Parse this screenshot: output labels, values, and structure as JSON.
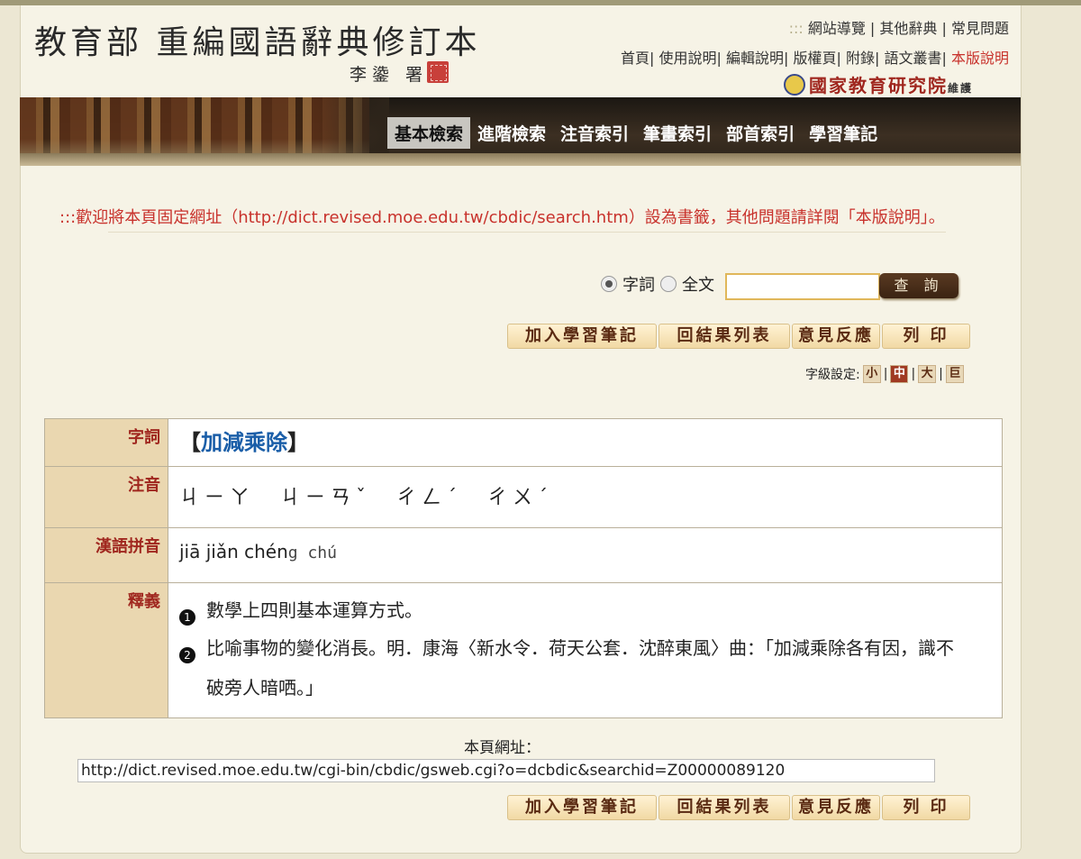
{
  "header": {
    "site_title": "教育部 重編國語辭典修訂本",
    "calligrapher": "李鍌 署",
    "top_links": [
      "網站導覽",
      "其他辭典",
      "常見問題"
    ],
    "main_links": [
      "首頁",
      "使用說明",
      "編輯說明",
      "版權頁",
      "附錄",
      "語文叢書",
      "本版說明"
    ],
    "institute": "國家教育研究院",
    "institute_suffix": "維護"
  },
  "nav": {
    "tabs": [
      "基本檢索",
      "進階檢索",
      "注音索引",
      "筆畫索引",
      "部首索引",
      "學習筆記"
    ],
    "active": "基本檢索"
  },
  "notice": ":::歡迎將本頁固定網址（http://dict.revised.moe.edu.tw/cbdic/search.htm）設為書籤，其他問題請詳閱「本版說明」。",
  "search": {
    "option_word": "字詞",
    "option_fulltext": "全文",
    "selected": "字詞",
    "value": "",
    "button": "查 詢"
  },
  "actions": {
    "add_note": "加入學習筆記",
    "back_results": "回結果列表",
    "feedback": "意見反應",
    "print": "列 印"
  },
  "font_size": {
    "label": "字級設定:",
    "small": "小",
    "mid": "中",
    "big": "大",
    "huge": "巨",
    "selected": "中"
  },
  "entry": {
    "labels": {
      "word": "字詞",
      "zhuyin": "注音",
      "pinyin": "漢語拼音",
      "meaning": "釋義"
    },
    "bracket_open": "【",
    "word": "加減乘除",
    "bracket_close": "】",
    "zhuyin": "ㄐㄧㄚ　ㄐㄧㄢˇ　ㄔㄥˊ　ㄔㄨˊ",
    "pinyin_a": "jiā jiǎn chén",
    "pinyin_b": "g chú",
    "definitions": [
      {
        "num": "1",
        "text": "數學上四則基本運算方式。"
      },
      {
        "num": "2",
        "text": "比喻事物的變化消長。明．康海〈新水令．荷天公套．沈醉東風〉曲：「加減乘除各有因，識不破旁人暗哂。」"
      }
    ]
  },
  "page_url": {
    "label": "本頁網址：",
    "value": "http://dict.revised.moe.edu.tw/cgi-bin/cbdic/gsweb.cgi?o=dcbdic&searchid=Z00000089120"
  }
}
